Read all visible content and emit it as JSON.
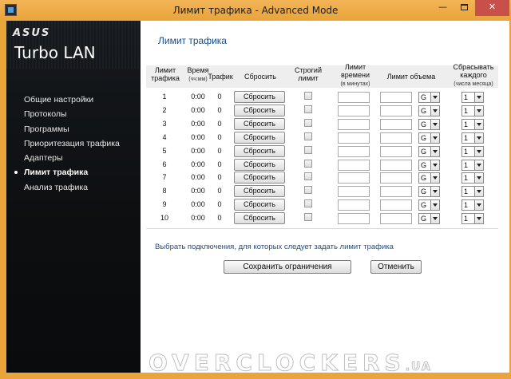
{
  "window": {
    "title": "Лимит трафика - Advanced Mode",
    "minimize_glyph": "—",
    "close_glyph": "✕"
  },
  "sidebar": {
    "brand": "ASUS",
    "product": "Turbo LAN",
    "items": [
      {
        "label": "Общие настройки",
        "active": false
      },
      {
        "label": "Протоколы",
        "active": false
      },
      {
        "label": "Программы",
        "active": false
      },
      {
        "label": "Приоритезация трафика",
        "active": false
      },
      {
        "label": "Адаптеры",
        "active": false
      },
      {
        "label": "Лимит трафика",
        "active": true
      },
      {
        "label": "Анализ трафика",
        "active": false
      }
    ]
  },
  "main": {
    "title": "Лимит трафика",
    "headers": {
      "limit": "Лимит трафика",
      "time": "Время",
      "time_unit": "(чч:мм)",
      "traffic": "Трафик",
      "reset": "Сбросить",
      "strict": "Строгий лимит",
      "time_limit": "Лимит времени",
      "time_limit_unit": "(в минутах)",
      "volume": "Лимит объема",
      "reset_every": "Сбрасывать каждого",
      "reset_every_unit": "(числа месяца)"
    },
    "rows": [
      {
        "num": "1",
        "time": "0:00",
        "traffic": "0",
        "reset": "Сбросить",
        "unit": "G",
        "day": "1"
      },
      {
        "num": "2",
        "time": "0:00",
        "traffic": "0",
        "reset": "Сбросить",
        "unit": "G",
        "day": "1"
      },
      {
        "num": "3",
        "time": "0:00",
        "traffic": "0",
        "reset": "Сбросить",
        "unit": "G",
        "day": "1"
      },
      {
        "num": "4",
        "time": "0:00",
        "traffic": "0",
        "reset": "Сбросить",
        "unit": "G",
        "day": "1"
      },
      {
        "num": "5",
        "time": "0:00",
        "traffic": "0",
        "reset": "Сбросить",
        "unit": "G",
        "day": "1"
      },
      {
        "num": "6",
        "time": "0:00",
        "traffic": "0",
        "reset": "Сбросить",
        "unit": "G",
        "day": "1"
      },
      {
        "num": "7",
        "time": "0:00",
        "traffic": "0",
        "reset": "Сбросить",
        "unit": "G",
        "day": "1"
      },
      {
        "num": "8",
        "time": "0:00",
        "traffic": "0",
        "reset": "Сбросить",
        "unit": "G",
        "day": "1"
      },
      {
        "num": "9",
        "time": "0:00",
        "traffic": "0",
        "reset": "Сбросить",
        "unit": "G",
        "day": "1"
      },
      {
        "num": "10",
        "time": "0:00",
        "traffic": "0",
        "reset": "Сбросить",
        "unit": "G",
        "day": "1"
      }
    ],
    "hint": "Выбрать подключения, для которых следует задать лимит трафика",
    "save_label": "Сохранить ограничения",
    "cancel_label": "Отменить"
  },
  "watermark": {
    "main": "OVERCLOCKERS",
    "suffix": ".UA"
  },
  "colors": {
    "frame": "#e9a43a",
    "sidebar": "#111417",
    "link": "#1a4d8c",
    "close": "#c7504b"
  }
}
